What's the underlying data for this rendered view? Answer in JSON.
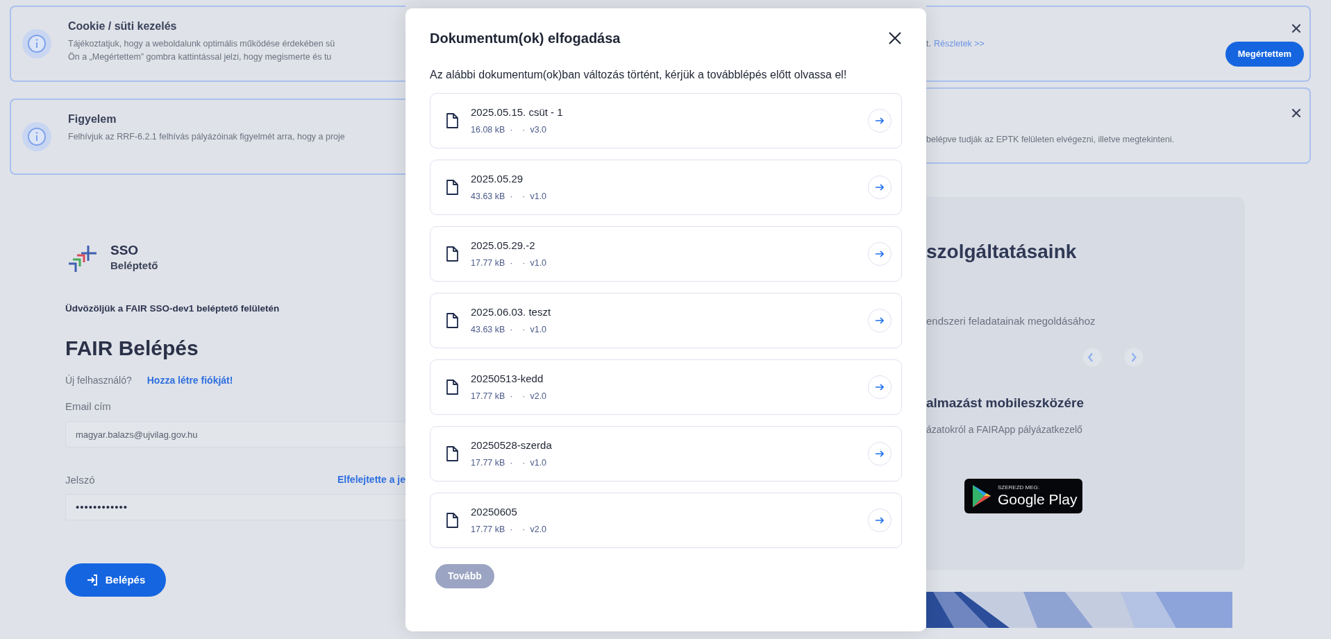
{
  "background": {
    "banners": [
      {
        "title": "Cookie / süti kezelés",
        "lines": [
          "Tájékoztatjuk, hogy a weboldalunk optimális működése érdekében sü",
          "Ön a „Megértettem” gombra kattintással jelzi, hogy megismerte és tu"
        ],
        "right_text": "t.",
        "link": "Részletek >>",
        "button": "Megértettem"
      },
      {
        "title": "Figyelem",
        "lines": [
          "Felhívjuk az RRF-6.2.1 felhívás pályázóinak figyelmét arra, hogy a proje"
        ],
        "right_text": "belépve tudják az EPTK felületen elvégezni, illetve megtekinteni."
      }
    ],
    "login": {
      "brand": "SSO",
      "subtitle": "Beléptető",
      "welcome": "Üdvözöljük a FAIR SSO-dev1 beléptető felületén",
      "heading": "FAIR Belépés",
      "new_user": "Új felhasználó?",
      "register_link": "Hozza létre fiókját!",
      "email_label": "Email cím",
      "email_value": "magyar.balazs@ujvilag.gov.hu",
      "password_label": "Jelszó",
      "forgot_link": "Elfelejtette a je",
      "password_value": "••••••••••••",
      "submit": "Belépés"
    },
    "promo": {
      "heading": "szolgáltatásaink",
      "text": "endszeri feladatainak megoldásához",
      "app_heading": "almazást mobileszközére",
      "app_text": "ázatokról a FAIRApp pályázatkezelő",
      "store_badge": {
        "small": "SZEREZD MEG:",
        "large": "Google Play"
      }
    }
  },
  "modal": {
    "title": "Dokumentum(ok) elfogadása",
    "description": "Az alábbi dokumentum(ok)ban változás történt, kérjük a továbblépés előtt olvassa el!",
    "documents": [
      {
        "name": "2025.05.15. csüt - 1",
        "meta": "16.08 kB  ·    ·  v3.0"
      },
      {
        "name": "2025.05.29",
        "meta": "43.63 kB  ·    ·  v1.0"
      },
      {
        "name": "2025.05.29.-2",
        "meta": "17.77 kB  ·    ·  v1.0"
      },
      {
        "name": "2025.06.03. teszt",
        "meta": "43.63 kB  ·    ·  v1.0"
      },
      {
        "name": "20250513-kedd",
        "meta": "17.77 kB  ·    ·  v2.0"
      },
      {
        "name": "20250528-szerda",
        "meta": "17.77 kB  ·    ·  v1.0"
      },
      {
        "name": "20250605",
        "meta": "17.77 kB  ·    ·  v2.0"
      }
    ],
    "continue_button": {
      "label": "Tovább",
      "disabled": true
    }
  }
}
